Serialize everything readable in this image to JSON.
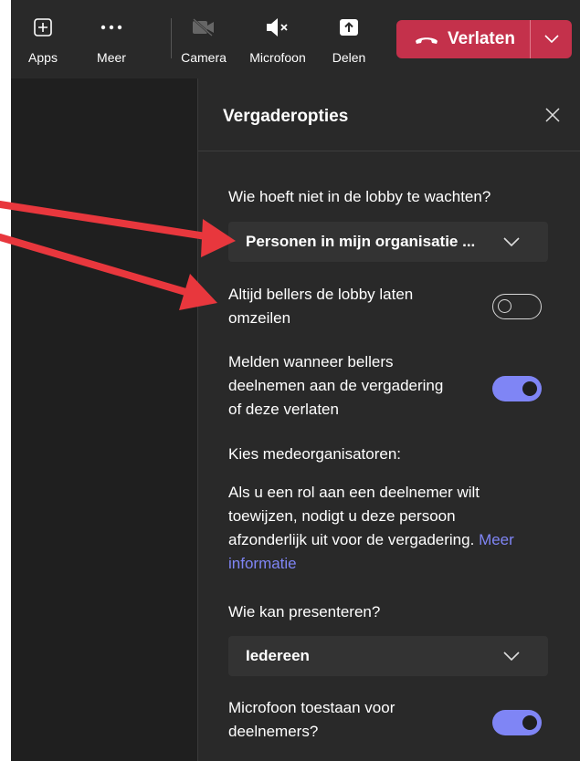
{
  "toolbar": {
    "apps_label": "Apps",
    "more_label": "Meer",
    "camera_label": "Camera",
    "mic_label": "Microfoon",
    "share_label": "Delen",
    "leave_label": "Verlaten"
  },
  "panel": {
    "title": "Vergaderopties",
    "lobby_question": "Wie hoeft niet in de lobby te wachten?",
    "lobby_value": "Personen in mijn organisatie ...",
    "bypass_label_line1": "Altijd bellers de lobby laten",
    "bypass_label_line2": "omzeilen",
    "bypass_on": false,
    "announce_line1": "Melden wanneer bellers",
    "announce_line2": "deelnemen aan de vergadering",
    "announce_line3": "of deze verlaten",
    "announce_on": true,
    "coorg_label": "Kies medeorganisatoren:",
    "info_line1": "Als u een rol aan een deelnemer wilt",
    "info_line2": "toewijzen, nodigt u deze persoon",
    "info_line3": "afzonderlijk uit voor de vergadering.",
    "info_link_part1": "Meer",
    "info_link_part2": "informatie",
    "present_question": "Wie kan presenteren?",
    "present_value": "Iedereen",
    "mic_line1": "Microfoon toestaan voor",
    "mic_line2": "deelnemers?",
    "mic_on": true
  },
  "colors": {
    "accent": "#7f85f5",
    "leave": "#c4314b",
    "annotation_arrow": "#e8373d"
  }
}
